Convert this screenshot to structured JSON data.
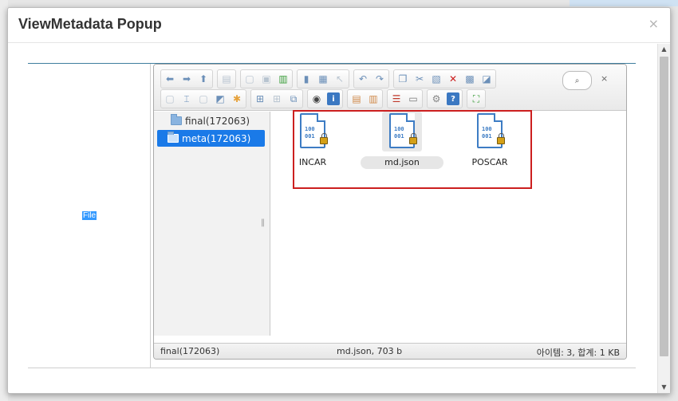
{
  "modal": {
    "title": "ViewMetadata Popup",
    "close_label": "×"
  },
  "form": {
    "file_label": "File"
  },
  "elfinder": {
    "toolbar": {
      "groups_row1": [
        [
          "arrow-left-icon",
          "arrow-right-icon",
          "arrow-up-icon"
        ],
        [
          "reload-icon"
        ],
        [
          "mkdir-icon",
          "mkfile-icon",
          "upload-icon"
        ],
        [
          "open-icon",
          "download-icon",
          "getfile-icon"
        ],
        [
          "undo-icon",
          "redo-icon"
        ],
        [
          "copy-icon",
          "cut-icon",
          "paste-icon",
          "delete-icon",
          "empty-icon",
          "hide-icon"
        ]
      ],
      "groups_row2": [
        [
          "duplicate-icon",
          "rename-icon",
          "edit-icon",
          "resize-icon",
          "extract-icon"
        ],
        [
          "icons-view-icon",
          "list-view-icon",
          "columns-view-icon"
        ],
        [
          "preview-icon",
          "info-icon"
        ],
        [
          "archive-icon",
          "extract-archive-icon"
        ],
        [
          "sort-icon",
          "selectall-icon"
        ],
        [
          "preferences-icon",
          "help-icon"
        ],
        [
          "fullscreen-icon"
        ]
      ],
      "search_placeholder": "⌕",
      "search_clear": "×"
    },
    "tree": [
      {
        "label": "final(172063)",
        "selected": false
      },
      {
        "label": "meta(172063)",
        "selected": true
      }
    ],
    "files": [
      {
        "name": "INCAR",
        "binary": "100\n001"
      },
      {
        "name": "md.json",
        "binary": "100\n001"
      },
      {
        "name": "POSCAR",
        "binary": "100\n001"
      }
    ],
    "status": {
      "path": "final(172063)",
      "selection": "md.json, 703 b",
      "summary": "아이템: 3, 합계: 1 KB"
    }
  }
}
